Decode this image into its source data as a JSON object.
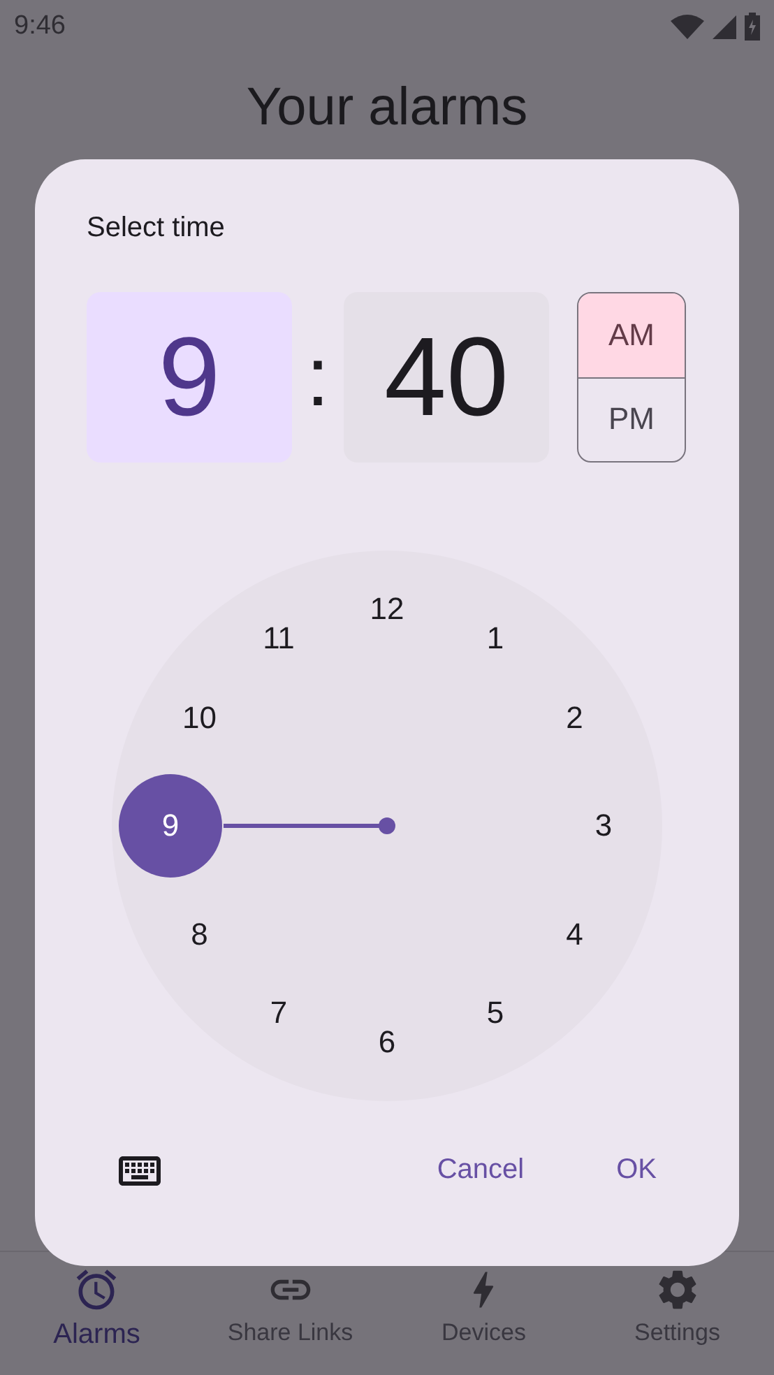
{
  "status_bar": {
    "time": "9:46"
  },
  "page": {
    "title": "Your alarms"
  },
  "dialog": {
    "title": "Select time",
    "fields": [
      {
        "value": "9",
        "selected": true
      },
      {
        "value": "40",
        "selected": false
      }
    ],
    "separator": ":",
    "periods": [
      {
        "label": "AM",
        "selected": true
      },
      {
        "label": "PM",
        "selected": false
      }
    ],
    "dial": [
      {
        "label": "12",
        "selected": false
      },
      {
        "label": "1",
        "selected": false
      },
      {
        "label": "2",
        "selected": false
      },
      {
        "label": "3",
        "selected": false
      },
      {
        "label": "4",
        "selected": false
      },
      {
        "label": "5",
        "selected": false
      },
      {
        "label": "6",
        "selected": false
      },
      {
        "label": "7",
        "selected": false
      },
      {
        "label": "8",
        "selected": false
      },
      {
        "label": "9",
        "selected": true
      },
      {
        "label": "10",
        "selected": false
      },
      {
        "label": "11",
        "selected": false
      }
    ],
    "buttons": [
      "Cancel",
      "OK"
    ]
  },
  "nav": [
    {
      "label": "Alarms",
      "selected": true
    },
    {
      "label": "Share Links",
      "selected": false
    },
    {
      "label": "Devices",
      "selected": false
    },
    {
      "label": "Settings",
      "selected": false
    }
  ]
}
